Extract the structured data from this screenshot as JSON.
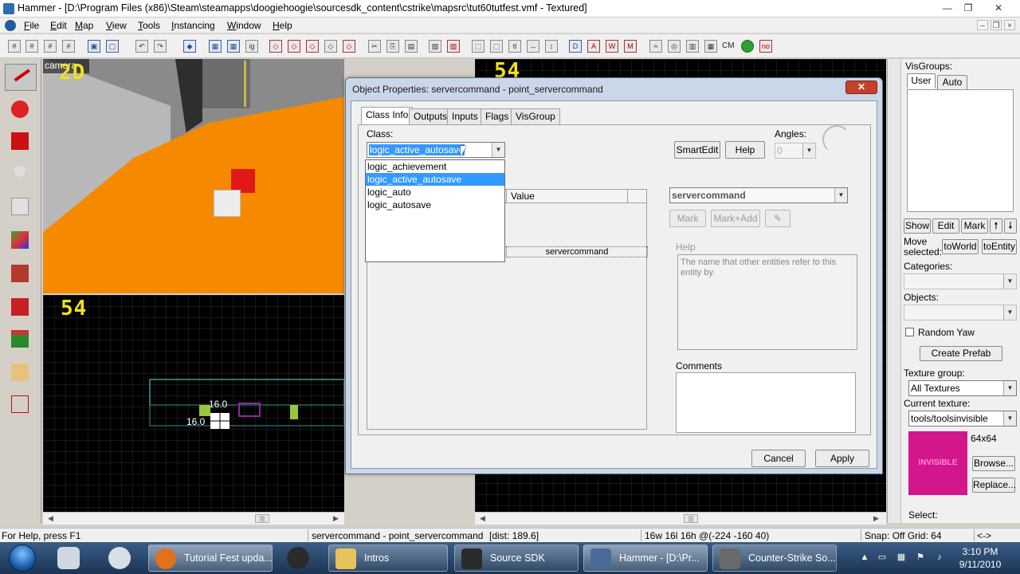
{
  "window": {
    "title": "Hammer - [D:\\Program Files (x86)\\Steam\\steamapps\\doogiehoogie\\sourcesdk_content\\cstrike\\mapsrc\\tut60tutfest.vmf - Textured]",
    "minimize": "—",
    "restore": "❐",
    "close": "✕"
  },
  "menubar": {
    "items": [
      {
        "key": "F",
        "rest": "ile"
      },
      {
        "key": "E",
        "rest": "dit"
      },
      {
        "key": "M",
        "rest": "ap"
      },
      {
        "key": "V",
        "rest": "iew"
      },
      {
        "key": "T",
        "rest": "ools"
      },
      {
        "key": "I",
        "rest": "nstancing"
      },
      {
        "key": "W",
        "rest": "indow"
      },
      {
        "key": "H",
        "rest": "elp"
      }
    ]
  },
  "toolbar": {
    "cm_label": "CM"
  },
  "viewports": {
    "camera_label": "camera",
    "camera_zoom": "2D",
    "top_left_zoom": "54",
    "right_zoom": "54",
    "dim_width": "16.0",
    "dim_height": "16.0"
  },
  "dialog": {
    "title": "Object Properties: servercommand - point_servercommand",
    "close": "✕",
    "tabs": [
      "Class Info",
      "Outputs",
      "Inputs",
      "Flags",
      "VisGroup"
    ],
    "class_label": "Class:",
    "class_value": "logic_active_autosave",
    "class_options": [
      "logic_achievement",
      "logic_active_autosave",
      "logic_auto",
      "logic_autosave"
    ],
    "smartedit": "SmartEdit",
    "help": "Help",
    "angles_label": "Angles:",
    "angles_value": "0",
    "value_header": "Value",
    "value_combo": "servercommand",
    "mark": "Mark",
    "mark_add": "Mark+Add",
    "row_value": "servercommand",
    "help_label": "Help",
    "help_text": "The name that other entities refer to this entity by.",
    "comments_label": "Comments",
    "cancel": "Cancel",
    "apply": "Apply"
  },
  "rightpanel": {
    "visgroups_label": "VisGroups:",
    "tab_user": "User",
    "tab_auto": "Auto",
    "show": "Show",
    "edit": "Edit",
    "mark": "Mark",
    "up": "🠕",
    "down": "🠗",
    "move_selected": "Move selected:",
    "to_world": "toWorld",
    "to_entity": "toEntity",
    "categories_label": "Categories:",
    "objects_label": "Objects:",
    "random_yaw": "Random Yaw",
    "create_prefab": "Create Prefab",
    "texture_group_label": "Texture group:",
    "texture_group": "All Textures",
    "current_texture_label": "Current texture:",
    "current_texture": "tools/toolsinvisible",
    "texture_size": "64x64",
    "texture_preview_text": "INVISIBLE",
    "browse": "Browse...",
    "replace": "Replace...",
    "select_label": "Select:"
  },
  "statusbar": {
    "help": "For Help, press F1",
    "selection": "servercommand - point_servercommand",
    "dist": "[dist: 189.6]",
    "size": "16w 16l 16h @(-224 -160 40)",
    "snap": "Snap: Off Grid: 64",
    "arrows": "<->"
  },
  "taskbar": {
    "tasks": [
      {
        "label": "Tutorial Fest upda...",
        "color": "#e2701c"
      },
      {
        "label": "Intros",
        "color": "#e8c25a"
      },
      {
        "label": "Source SDK",
        "color": "#2b2b2b"
      },
      {
        "label": "Hammer - [D:\\Pr...",
        "color": "#4a6a9a"
      },
      {
        "label": "Counter-Strike So...",
        "color": "#6a6a6a"
      }
    ],
    "time": "3:10 PM",
    "date": "9/11/2010"
  },
  "colors": {
    "orange_floor": "#f58a00",
    "grid_line": "#2c2c2c",
    "selection_cyan": "#6ee0e0",
    "texture_magenta": "#d4168c",
    "highlight": "#3399ff"
  }
}
